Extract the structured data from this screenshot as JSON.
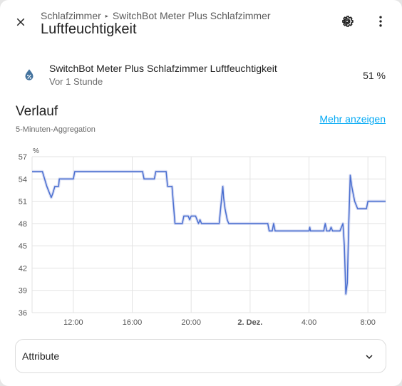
{
  "header": {
    "breadcrumb_area": "Schlafzimmer",
    "breadcrumb_device": "SwitchBot Meter Plus Schlafzimmer",
    "title": "Luftfeuchtigkeit"
  },
  "icons": {
    "close": "close-icon",
    "settings": "gear-icon",
    "more": "more-vertical-icon",
    "entity": "water-percent-icon",
    "expand": "chevron-down-icon"
  },
  "entity": {
    "name": "SwitchBot Meter Plus Schlafzimmer Luftfeuchtigkeit",
    "last_changed": "Vor 1 Stunde",
    "state": "51 %"
  },
  "history": {
    "title": "Verlauf",
    "subtitle": "5-Minuten-Aggregation",
    "more_link": "Mehr anzeigen"
  },
  "attributes": {
    "label": "Attribute"
  },
  "colors": {
    "accent": "#03a9f4",
    "line": "#4a6fd0",
    "band": "#c7cff0",
    "icon": "#44739e"
  },
  "chart_data": {
    "type": "line",
    "unit": "%",
    "ylim": [
      36,
      57
    ],
    "yticks": [
      57,
      54,
      51,
      48,
      45,
      42,
      39,
      36
    ],
    "x_start_hours": 9.2,
    "x_end_hours": 33.2,
    "xticks": [
      {
        "h": 12,
        "label": "12:00",
        "bold": false
      },
      {
        "h": 16,
        "label": "16:00",
        "bold": false
      },
      {
        "h": 20,
        "label": "20:00",
        "bold": false
      },
      {
        "h": 24,
        "label": "2. Dez.",
        "bold": true
      },
      {
        "h": 28,
        "label": "4:00",
        "bold": false
      },
      {
        "h": 32,
        "label": "8:00",
        "bold": false
      }
    ],
    "grid": true,
    "series": [
      {
        "name": "",
        "points": [
          [
            9.2,
            55
          ],
          [
            9.9,
            55
          ],
          [
            10.05,
            54
          ],
          [
            10.2,
            53
          ],
          [
            10.4,
            52
          ],
          [
            10.5,
            51.5
          ],
          [
            10.6,
            52
          ],
          [
            10.75,
            53
          ],
          [
            11.0,
            53
          ],
          [
            11.05,
            54
          ],
          [
            11.2,
            54
          ],
          [
            11.9,
            54
          ],
          [
            12.0,
            54
          ],
          [
            12.1,
            55
          ],
          [
            12.5,
            55
          ],
          [
            13.0,
            55
          ],
          [
            14.0,
            55
          ],
          [
            15.0,
            55
          ],
          [
            16.0,
            55
          ],
          [
            16.7,
            55
          ],
          [
            16.8,
            54
          ],
          [
            17.5,
            54
          ],
          [
            17.6,
            55
          ],
          [
            18.3,
            55
          ],
          [
            18.4,
            53
          ],
          [
            18.7,
            53
          ],
          [
            18.9,
            48
          ],
          [
            19.4,
            48
          ],
          [
            19.5,
            49
          ],
          [
            19.8,
            49
          ],
          [
            19.9,
            48.5
          ],
          [
            20.0,
            49
          ],
          [
            20.3,
            49
          ],
          [
            20.5,
            48
          ],
          [
            20.6,
            48.5
          ],
          [
            20.7,
            48
          ],
          [
            21.6,
            48
          ],
          [
            21.9,
            48
          ],
          [
            22.0,
            50
          ],
          [
            22.15,
            53
          ],
          [
            22.2,
            51.5
          ],
          [
            22.3,
            50
          ],
          [
            22.45,
            48.5
          ],
          [
            22.55,
            48
          ],
          [
            23.5,
            48
          ],
          [
            24.5,
            48
          ],
          [
            25.2,
            48
          ],
          [
            25.3,
            47
          ],
          [
            25.5,
            47
          ],
          [
            25.6,
            48
          ],
          [
            25.7,
            47
          ],
          [
            27.3,
            47
          ],
          [
            28.0,
            47
          ],
          [
            28.05,
            47.5
          ],
          [
            28.1,
            47
          ],
          [
            28.8,
            47
          ],
          [
            29.0,
            47
          ],
          [
            29.1,
            48
          ],
          [
            29.2,
            47
          ],
          [
            29.4,
            47
          ],
          [
            29.5,
            47.5
          ],
          [
            29.6,
            47
          ],
          [
            30.1,
            47
          ],
          [
            30.2,
            47.5
          ],
          [
            30.3,
            48
          ],
          [
            30.4,
            45
          ],
          [
            30.5,
            38.5
          ],
          [
            30.6,
            40
          ],
          [
            30.7,
            48
          ],
          [
            30.8,
            54.5
          ],
          [
            30.9,
            53
          ],
          [
            31.0,
            52
          ],
          [
            31.1,
            51
          ],
          [
            31.3,
            50
          ],
          [
            31.5,
            50
          ],
          [
            31.9,
            50
          ],
          [
            32.0,
            51
          ],
          [
            32.6,
            51
          ],
          [
            33.2,
            51
          ]
        ]
      }
    ]
  }
}
